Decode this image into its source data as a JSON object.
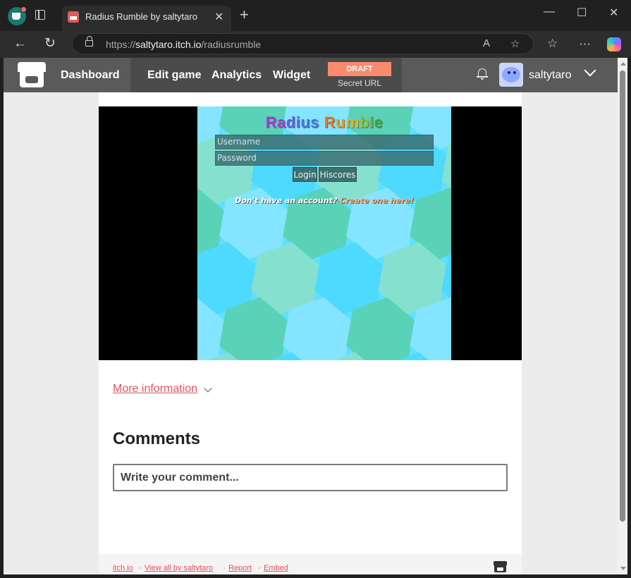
{
  "browser": {
    "tab_title": "Radius Rumble by saltytaro",
    "url_prefix": "https://",
    "url_host": "saltytaro.itch.io",
    "url_path": "/radiusrumble"
  },
  "itch_header": {
    "dashboard": "Dashboard",
    "edit_game": "Edit game",
    "analytics": "Analytics",
    "widget": "Widget",
    "draft_badge": "DRAFT",
    "secret_url": "Secret URL",
    "username": "saltytaro"
  },
  "game": {
    "title_letters": [
      {
        "ch": "R",
        "color": "#a23cd6"
      },
      {
        "ch": "a",
        "color": "#a23cd6"
      },
      {
        "ch": "d",
        "color": "#5b62e0"
      },
      {
        "ch": "i",
        "color": "#5b62e0"
      },
      {
        "ch": "u",
        "color": "#3b7de0"
      },
      {
        "ch": "s",
        "color": "#3b7de0"
      },
      {
        "ch": " ",
        "color": "#000000"
      },
      {
        "ch": "R",
        "color": "#e07a2a"
      },
      {
        "ch": "u",
        "color": "#e0a12a"
      },
      {
        "ch": "m",
        "color": "#e0b82a"
      },
      {
        "ch": "b",
        "color": "#8fc23a"
      },
      {
        "ch": "l",
        "color": "#5ab84a"
      },
      {
        "ch": "e",
        "color": "#3aa84a"
      }
    ],
    "username_placeholder": "Username",
    "password_placeholder": "Password",
    "login_button": "Login",
    "hiscores_button": "Hiscores",
    "signup_prompt": "Don't have an account?",
    "signup_link": "Create one here!",
    "hex_colors": [
      "#5ad2b8",
      "#86e0cf",
      "#85e4ff",
      "#4ed9ff"
    ]
  },
  "page": {
    "more_information": "More information",
    "comments_heading": "Comments",
    "comment_placeholder": "Write your comment..."
  },
  "footer": {
    "links": [
      "itch.io",
      "View all by saltytaro",
      "Report",
      "Embed"
    ]
  }
}
